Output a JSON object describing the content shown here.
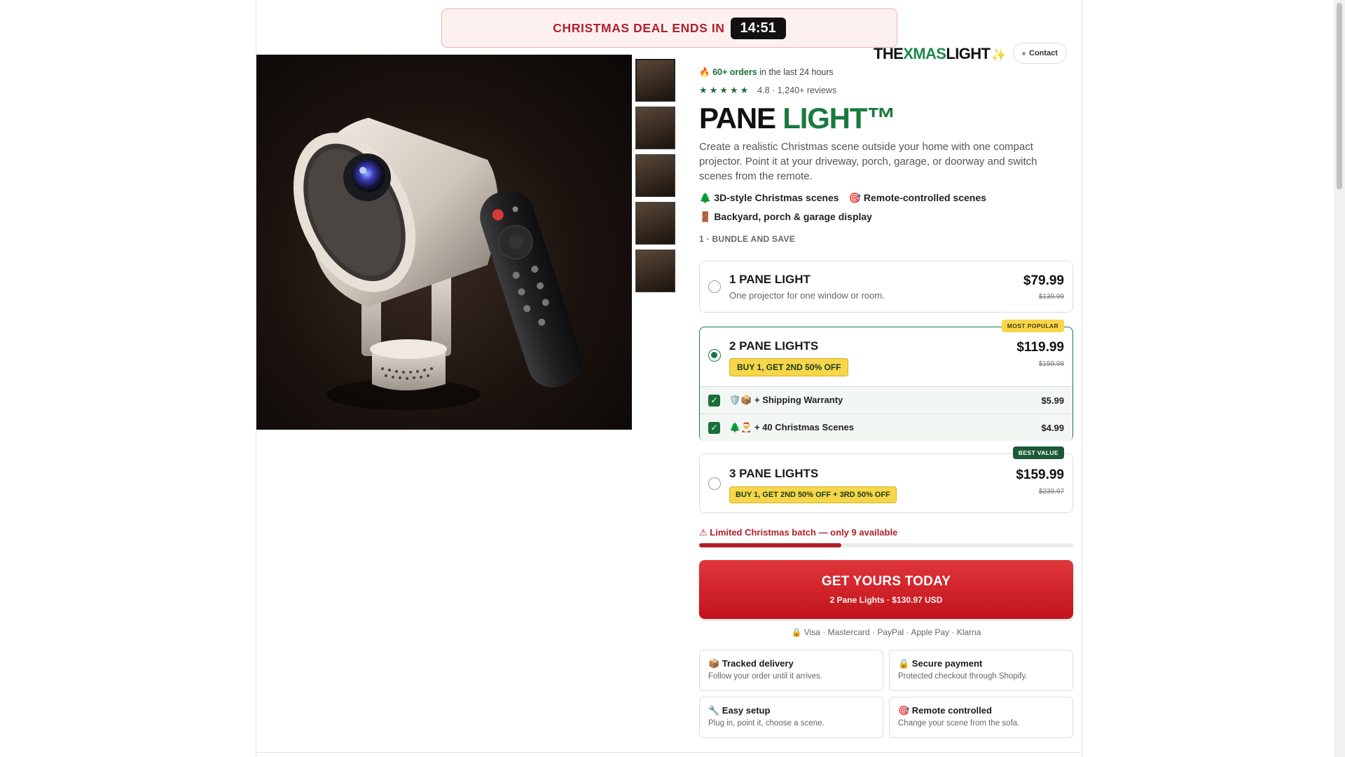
{
  "deal": {
    "text": "CHRISTMAS DEAL ENDS IN",
    "timer": "14:51"
  },
  "brand": {
    "logo_prefix": "THE",
    "logo_x": "XMAS",
    "logo_suffix": "LIGHT",
    "contact_label": "Contact"
  },
  "gallery": {
    "thumbnails": [
      "thumbnail-1",
      "thumbnail-2",
      "thumbnail-3",
      "thumbnail-4",
      "thumbnail-5"
    ]
  },
  "product": {
    "orders_fire": "🔥",
    "orders_count": "60+ orders",
    "orders_suffix": "in the last 24 hours",
    "stars": "★★★★★",
    "rating_text": "4.8 · 1,240+ reviews",
    "rating_value": 4.8,
    "title_main": "PANE",
    "title_accent": "LIGHT™",
    "description": "Create a realistic Christmas scene outside your home with one compact projector. Point it at your driveway, porch, garage, or doorway and switch scenes from the remote.",
    "features": [
      "🌲 3D-style Christmas scenes",
      "🎯 Remote-controlled scenes",
      "🚪 Backyard, porch & garage display"
    ]
  },
  "bundle": {
    "section_label": "1 · BUNDLE AND SAVE",
    "options": [
      {
        "name": "1 PANE LIGHT",
        "subtitle": "One projector for one window or room.",
        "price": "$79.99",
        "old_price": "$139.99",
        "selected": false
      },
      {
        "name": "2 PANE LIGHTS",
        "tag": "BUY 1, GET 2ND 50% OFF",
        "badge": "MOST POPULAR",
        "price": "$119.99",
        "old_price": "$159.98",
        "selected": true
      },
      {
        "name": "3 PANE LIGHTS",
        "tag": "BUY 1, GET 2ND 50% OFF + 3RD 50% OFF",
        "badge": "BEST VALUE",
        "price": "$159.99",
        "old_price": "$239.97",
        "selected": false
      }
    ],
    "addons": [
      {
        "label": "🛡️📦 + Shipping Warranty",
        "price": "$5.99",
        "checked": true
      },
      {
        "label": "🌲🎅 + 40 Christmas Scenes",
        "price": "$4.99",
        "checked": true
      }
    ]
  },
  "stock": {
    "text": "⚠ Limited Christmas batch — only 9 available",
    "level": 0.38
  },
  "cta": {
    "label": "GET YOURS TODAY",
    "summary": "2 Pane Lights · $130.97 USD"
  },
  "payments": "🔒 Visa · Mastercard · PayPal · Apple Pay · Klarna",
  "benefits": [
    {
      "title": "📦 Tracked delivery",
      "subtitle": "Follow your order until it arrives."
    },
    {
      "title": "🔒 Secure payment",
      "subtitle": "Protected checkout through Shopify."
    },
    {
      "title": "🔧 Easy setup",
      "subtitle": "Plug in, point it, choose a scene."
    },
    {
      "title": "🎯 Remote controlled",
      "subtitle": "Change your scene from the sofa."
    }
  ],
  "colors": {
    "accent_green": "#1a7a3e",
    "deal_red": "#b0202a",
    "cta_red": "#d3262c",
    "badge_yellow": "#f7d64a"
  }
}
